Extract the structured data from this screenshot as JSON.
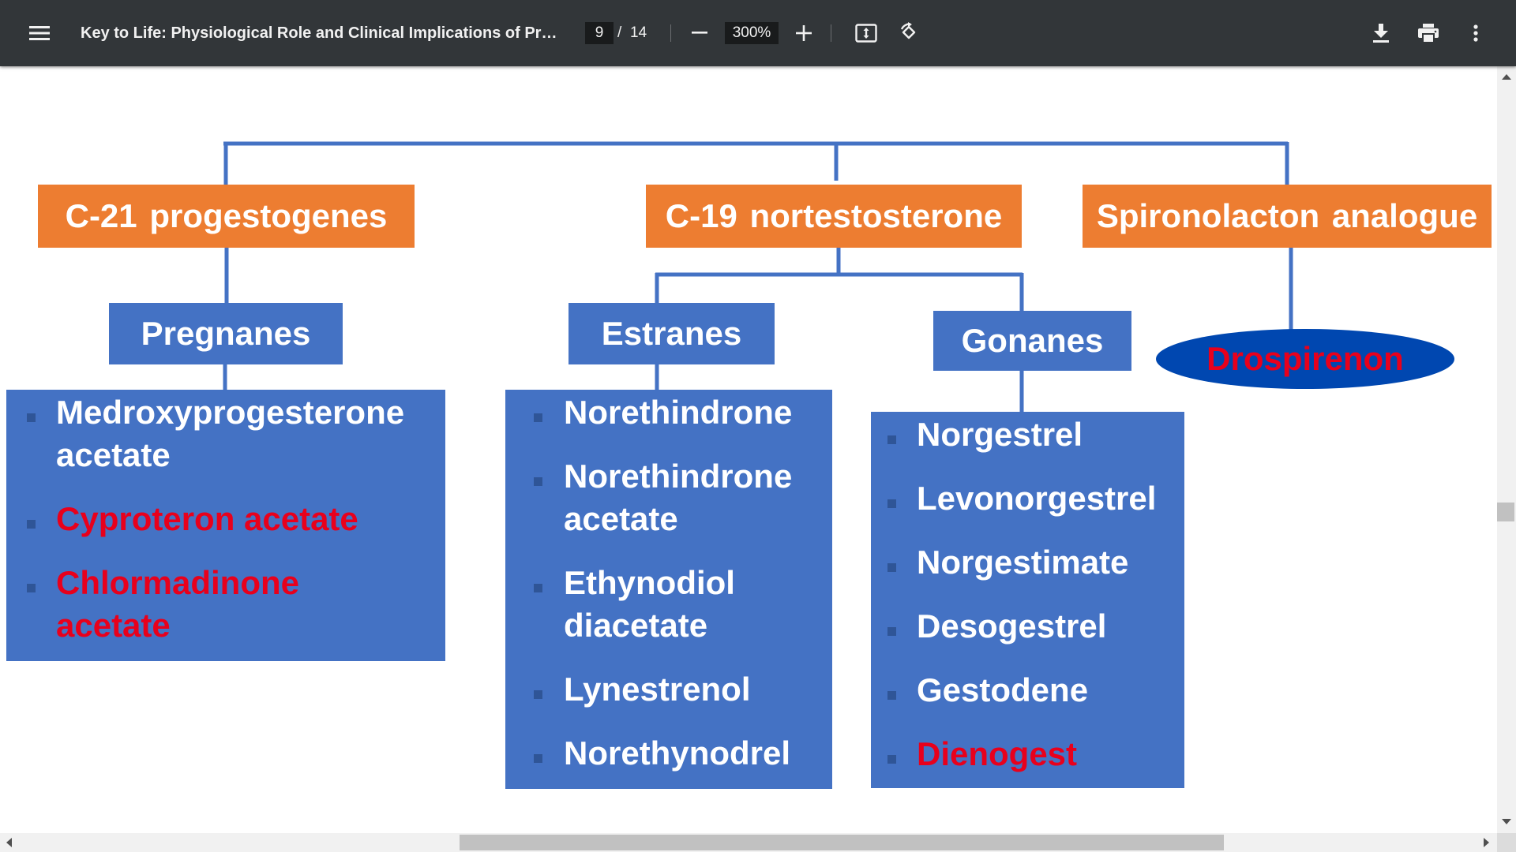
{
  "toolbar": {
    "menu_icon": "hamburger-menu-icon",
    "title": "Key to Life: Physiological Role and Clinical Implications of Prog...",
    "current_page": "9",
    "page_separator": "/",
    "total_pages": "14",
    "zoom_level": "300%",
    "icons": {
      "zoom_out": "minus-icon",
      "zoom_in": "plus-icon",
      "fit": "fit-to-page-icon",
      "rotate": "rotate-counterclockwise-icon",
      "download": "download-icon",
      "print": "print-icon",
      "more": "more-vertical-icon"
    },
    "background_color": "#323639"
  },
  "slide": {
    "colors": {
      "orange": "#ed7d31",
      "blue": "#4472c4",
      "connector": "#4472c4",
      "red_text": "#e8001c",
      "ellipse": "#0047b0"
    },
    "categories": {
      "c21": "C-21 progestogenes",
      "c19": "C-19 nortestosterone",
      "spiro": "Spironolacton analogue"
    },
    "subgroups": {
      "pregnanes": "Pregnanes",
      "estranes": "Estranes",
      "gonanes": "Gonanes",
      "drospirenon": "Drospirenon"
    },
    "pregnanes_list": [
      {
        "text": "Medroxyprogesterone acetate",
        "highlight": false
      },
      {
        "text": "Cyproteron acetate",
        "highlight": true
      },
      {
        "text": "Chlormadinone acetate",
        "highlight": true
      }
    ],
    "estranes_list": [
      {
        "text": "Norethindrone",
        "highlight": false
      },
      {
        "text": "Norethindrone acetate",
        "highlight": false
      },
      {
        "text": "Ethynodiol diacetate",
        "highlight": false
      },
      {
        "text": "Lynestrenol",
        "highlight": false
      },
      {
        "text": "Norethynodrel",
        "highlight": false
      }
    ],
    "gonanes_list": [
      {
        "text": "Norgestrel",
        "highlight": false
      },
      {
        "text": "Levonorgestrel",
        "highlight": false
      },
      {
        "text": "Norgestimate",
        "highlight": false
      },
      {
        "text": "Desogestrel",
        "highlight": false
      },
      {
        "text": "Gestodene",
        "highlight": false
      },
      {
        "text": "Dienogest",
        "highlight": true
      }
    ]
  }
}
